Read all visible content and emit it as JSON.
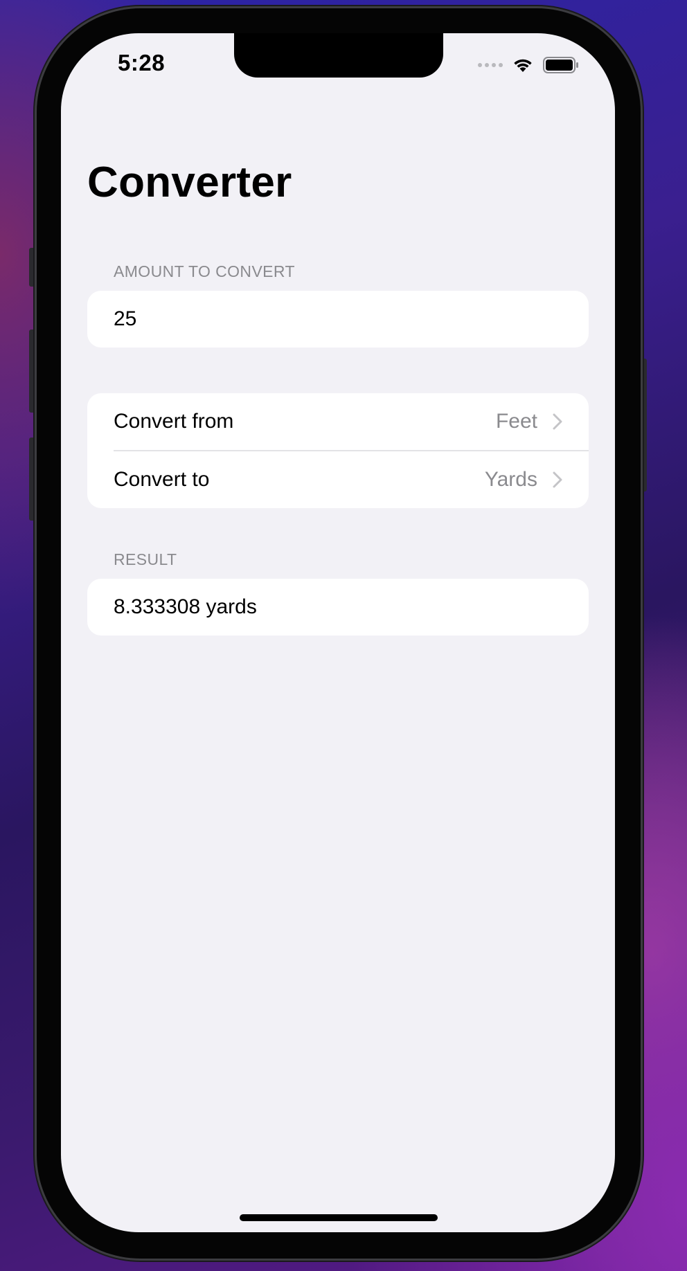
{
  "status_bar": {
    "time": "5:28"
  },
  "screen": {
    "title": "Converter"
  },
  "amount_section": {
    "header": "AMOUNT TO CONVERT",
    "value": "25"
  },
  "units_section": {
    "from_label": "Convert from",
    "from_value": "Feet",
    "to_label": "Convert to",
    "to_value": "Yards"
  },
  "result_section": {
    "header": "RESULT",
    "value": "8.333308 yards"
  },
  "colors": {
    "background": "#f2f1f6",
    "card": "#ffffff",
    "secondary_text": "#8a8a8e"
  }
}
